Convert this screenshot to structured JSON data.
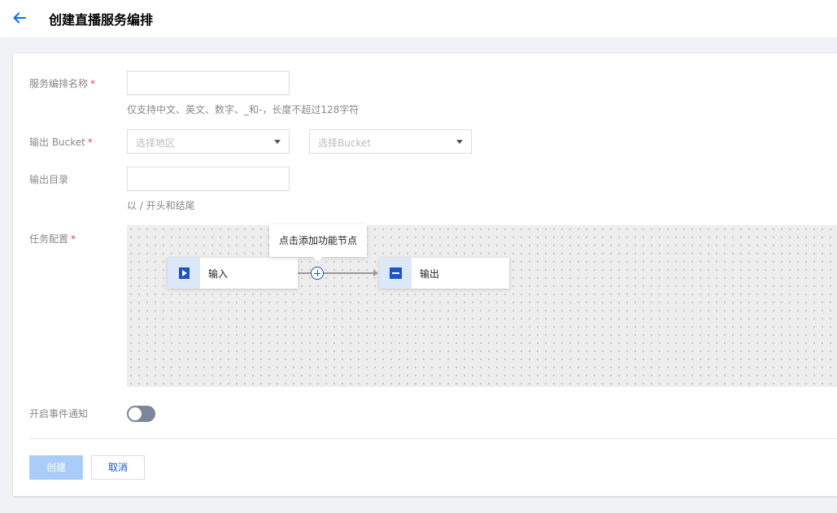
{
  "header": {
    "title": "创建直播服务编排",
    "back_icon": "arrow-left-icon"
  },
  "colors": {
    "accent": "#006eff",
    "required": "#e54545",
    "node_icon": "#1b54c5",
    "primary_disabled": "#a9cdf8"
  },
  "form": {
    "name": {
      "label": "服务编排名称",
      "required_mark": "*",
      "value": "",
      "help": "仅支持中文、英文、数字、_和-，长度不超过128字符"
    },
    "bucket": {
      "label": "输出 Bucket",
      "required_mark": "*",
      "region_placeholder": "选择地区",
      "bucket_placeholder": "选择Bucket"
    },
    "directory": {
      "label": "输出目录",
      "value": "",
      "help": "以 / 开头和结尾"
    },
    "task": {
      "label": "任务配置",
      "required_mark": "*",
      "tooltip": "点击添加功能节点",
      "input_node": {
        "label": "输入",
        "icon": "play-icon"
      },
      "output_node": {
        "label": "输出",
        "icon": "output-icon"
      },
      "add_icon": "plus-circle-icon"
    },
    "notify": {
      "label": "开启事件通知",
      "enabled": false
    }
  },
  "actions": {
    "create_label": "创建",
    "cancel_label": "取消"
  }
}
